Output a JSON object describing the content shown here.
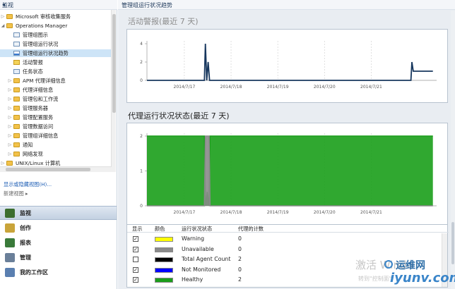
{
  "nav": {
    "title": "监视",
    "tree": [
      {
        "label": "Microsoft 审核收集服务",
        "level": 1,
        "icon": "folder",
        "expander": "collapsed"
      },
      {
        "label": "Operations Manager",
        "level": 1,
        "icon": "folder",
        "expander": "expanded"
      },
      {
        "label": "管理组图示",
        "level": 2,
        "icon": "view",
        "expander": ""
      },
      {
        "label": "管理组运行状况",
        "level": 2,
        "icon": "view",
        "expander": ""
      },
      {
        "label": "管理组运行状况趋势",
        "level": 2,
        "icon": "chart",
        "expander": "",
        "selected": true
      },
      {
        "label": "活动警报",
        "level": 2,
        "icon": "alert",
        "expander": ""
      },
      {
        "label": "任务状态",
        "level": 2,
        "icon": "task",
        "expander": ""
      },
      {
        "label": "APM 代理详细信息",
        "level": 2,
        "icon": "folder",
        "expander": "collapsed"
      },
      {
        "label": "代理详细信息",
        "level": 2,
        "icon": "folder",
        "expander": "collapsed"
      },
      {
        "label": "管理包和工作流",
        "level": 2,
        "icon": "folder",
        "expander": "collapsed"
      },
      {
        "label": "管理服务器",
        "level": 2,
        "icon": "folder",
        "expander": "collapsed"
      },
      {
        "label": "管理配置服务",
        "level": 2,
        "icon": "folder",
        "expander": "collapsed"
      },
      {
        "label": "管理数据访问",
        "level": 2,
        "icon": "folder",
        "expander": "collapsed"
      },
      {
        "label": "管理组详细信息",
        "level": 2,
        "icon": "folder",
        "expander": "collapsed"
      },
      {
        "label": "通知",
        "level": 2,
        "icon": "folder",
        "expander": "collapsed"
      },
      {
        "label": "网络发现",
        "level": 2,
        "icon": "folder",
        "expander": "collapsed"
      },
      {
        "label": "UNIX/Linux 计算机",
        "level": 1,
        "icon": "folder",
        "expander": "collapsed"
      }
    ],
    "show_hide_link": "显示或隐藏视图(H)...",
    "new_view_link": "新建视图 ▸",
    "workspaces": [
      {
        "label": "监视",
        "color": "#3c6e2f"
      },
      {
        "label": "创作",
        "color": "#c9a43a"
      },
      {
        "label": "报表",
        "color": "#3a7a3a"
      },
      {
        "label": "管理",
        "color": "#6a7f99"
      },
      {
        "label": "我的工作区",
        "color": "#5a7fb0"
      }
    ]
  },
  "content": {
    "title": "管理组运行状况趋势",
    "alerts_section_title": "活动警报(最近 7 天)",
    "health_section_title": "代理运行状况状态(最近 7 天)"
  },
  "chart_data": [
    {
      "type": "line",
      "title": "活动警报(最近 7 天)",
      "xlabel": "",
      "ylabel": "",
      "ylim": [
        0,
        4
      ],
      "yticks": [
        "0",
        "2",
        "4"
      ],
      "xticks": [
        "2014/7/17",
        "2014/7/18",
        "2014/7/19",
        "2014/7/20",
        "2014/7/21"
      ],
      "grid": true,
      "series": [
        {
          "color": "#17375e",
          "x": [
            0,
            1.23,
            1.25,
            1.28,
            1.31,
            1.34,
            1.37,
            5.65,
            5.67,
            5.7,
            5.74,
            5.78,
            6.12
          ],
          "y": [
            0,
            0,
            4,
            0,
            2,
            0,
            0,
            0,
            2,
            1,
            1,
            1,
            1
          ]
        }
      ]
    },
    {
      "type": "area",
      "title": "代理运行状况状态(最近 7 天)",
      "xlabel": "",
      "ylabel": "",
      "ylim": [
        0,
        2
      ],
      "yticks": [
        "0",
        "1",
        "2"
      ],
      "xticks": [
        "2014/7/17",
        "2014/7/18",
        "2014/7/19",
        "2014/7/20",
        "2014/7/21"
      ],
      "grid": true,
      "series": [
        {
          "name": "Healthy",
          "color": "#1a9e1a",
          "x": [
            0,
            1.23,
            1.25,
            1.29,
            1.33,
            1.35,
            6.12
          ],
          "y": [
            2,
            2,
            0,
            0.4,
            0,
            2,
            2
          ]
        },
        {
          "name": "Unavailable",
          "color": "#8a8a8a",
          "x": [
            0,
            1.23,
            1.25,
            1.33,
            1.35,
            6.12
          ],
          "y": [
            0,
            0,
            2,
            2,
            0,
            0
          ]
        }
      ]
    }
  ],
  "legend": {
    "headers": [
      "显示",
      "颜色",
      "运行状况状态",
      "代理的计数"
    ],
    "rows": [
      {
        "checked": true,
        "color": "#ffff00",
        "state": "Warning",
        "count": "0"
      },
      {
        "checked": true,
        "color": "#8a8a8a",
        "state": "Unavailable",
        "count": "0"
      },
      {
        "checked": false,
        "color": "#000000",
        "state": "Total Agent Count",
        "count": "2"
      },
      {
        "checked": true,
        "color": "#0000ff",
        "state": "Not Monitored",
        "count": "0"
      },
      {
        "checked": true,
        "color": "#1a9e1a",
        "state": "Healthy",
        "count": "2"
      }
    ]
  },
  "watermark": {
    "activate": "激活 Windo",
    "activate_sub": "转到\"控制面\"",
    "brand": "运维网",
    "brand_url": "iyunv.com"
  }
}
